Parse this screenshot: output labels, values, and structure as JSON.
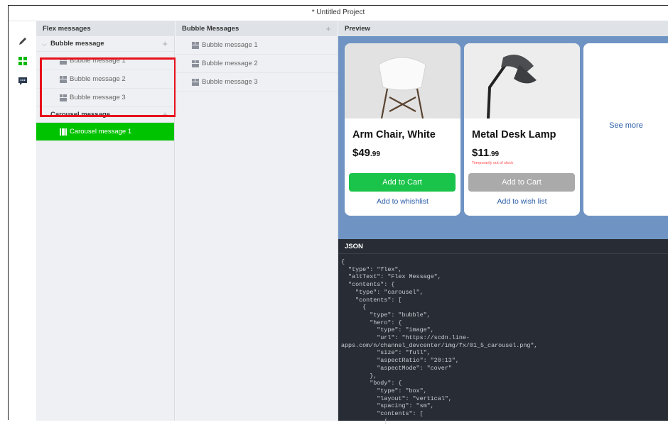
{
  "window": {
    "title": "* Untitled Project"
  },
  "rail": {
    "icons": [
      "pencil-icon",
      "grid-icon",
      "chat-icon"
    ]
  },
  "flex_panel": {
    "header": "Flex messages",
    "bubble_group": {
      "label": "Bubble message",
      "items": [
        "Bubble message 1",
        "Bubble message 2",
        "Bubble message 3"
      ]
    },
    "carousel_group": {
      "label": "Carousel message",
      "items": [
        "Carousel message 1"
      ]
    },
    "add_symbol": "+"
  },
  "bubble_panel": {
    "header": "Bubble Messages",
    "add_symbol": "+",
    "items": [
      "Bubble message 1",
      "Bubble message 2",
      "Bubble message 3"
    ]
  },
  "preview": {
    "header": "Preview",
    "cards": [
      {
        "name": "Arm Chair, White",
        "price_main": "$49",
        "price_cents": ".99",
        "stock_note": "",
        "button": "Add to Cart",
        "button_color": "#1ac44a",
        "link": "Add to whishlist"
      },
      {
        "name": "Metal Desk Lamp",
        "price_main": "$11",
        "price_cents": ".99",
        "stock_note": "Temporarily out of stock",
        "button": "Add to Cart",
        "button_color": "#aaaaaa",
        "link": "Add to wish list"
      }
    ],
    "see_more": "See more"
  },
  "json_panel": {
    "header": "JSON",
    "code": "{\n  \"type\": \"flex\",\n  \"altText\": \"Flex Message\",\n  \"contents\": {\n    \"type\": \"carousel\",\n    \"contents\": [\n      {\n        \"type\": \"bubble\",\n        \"hero\": {\n          \"type\": \"image\",\n          \"url\": \"https://scdn.line-\napps.com/n/channel_devcenter/img/fx/01_5_carousel.png\",\n          \"size\": \"full\",\n          \"aspectRatio\": \"20:13\",\n          \"aspectMode\": \"cover\"\n        },\n        \"body\": {\n          \"type\": \"box\",\n          \"layout\": \"vertical\",\n          \"spacing\": \"sm\",\n          \"contents\": [\n            {"
  },
  "colors": {
    "accent_green": "#00c300",
    "highlight_red": "#e8101b",
    "preview_bg": "#6f94c4",
    "link_blue": "#2c5ea8"
  }
}
